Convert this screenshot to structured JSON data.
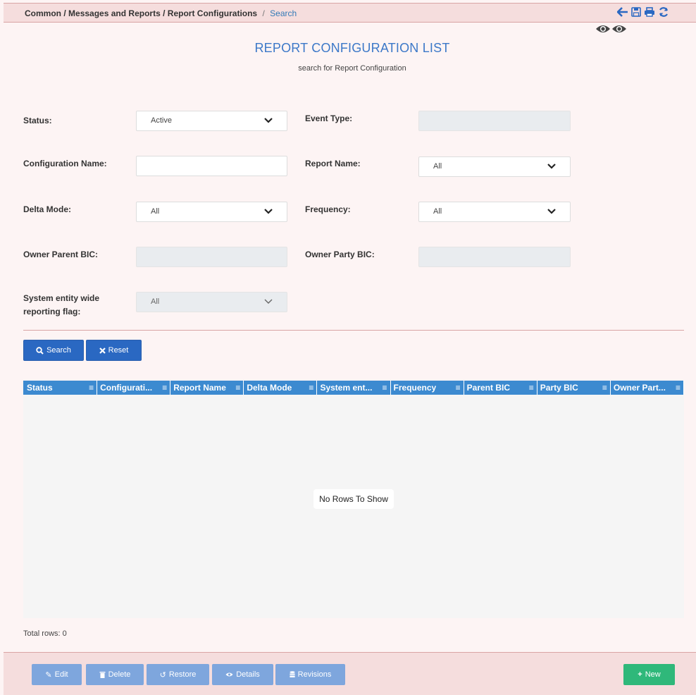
{
  "breadcrumb": {
    "items": [
      "Common",
      "Messages and Reports",
      "Report Configurations"
    ],
    "separator": "/",
    "active": "Search"
  },
  "header": {
    "icons": [
      "arrow-left-icon",
      "save-icon",
      "print-icon",
      "refresh-icon",
      "eye-icon",
      "eye-icon"
    ]
  },
  "page": {
    "title": "REPORT CONFIGURATION LIST",
    "subtitle": "search for Report Configuration"
  },
  "form": {
    "status_label": "Status:",
    "status_value": "Active",
    "event_type_label": "Event Type:",
    "event_type_value": "",
    "configuration_name_label": "Configuration Name:",
    "configuration_name_value": "",
    "report_name_label": "Report Name:",
    "report_name_value": "All",
    "delta_mode_label": "Delta Mode:",
    "delta_mode_value": "All",
    "frequency_label": "Frequency:",
    "frequency_value": "All",
    "owner_parent_bic_label": "Owner Parent BIC:",
    "owner_parent_bic_value": "",
    "owner_party_bic_label": "Owner Party BIC:",
    "owner_party_bic_value": "",
    "system_flag_label_line1": "System entity wide",
    "system_flag_label_line2": "reporting flag:",
    "system_flag_value": "All"
  },
  "actions": {
    "search_label": "Search",
    "reset_label": "Reset"
  },
  "grid": {
    "columns": [
      "Status",
      "Configurati...",
      "Report Name",
      "Delta Mode",
      "System ent...",
      "Frequency",
      "Parent BIC",
      "Party BIC",
      "Owner Part..."
    ],
    "empty_message": "No Rows To Show",
    "total_rows": "Total rows: 0"
  },
  "footer": {
    "edit_label": "Edit",
    "delete_label": "Delete",
    "restore_label": "Restore",
    "details_label": "Details",
    "revisions_label": "Revisions",
    "new_label": "New"
  },
  "colors": {
    "accent": "#2a68c2",
    "grid_header": "#3c8ad0",
    "new_button": "#2fb87a",
    "disabled_button": "#7ea6dd",
    "background": "#fdf4f4",
    "bar": "#f5dddd"
  }
}
